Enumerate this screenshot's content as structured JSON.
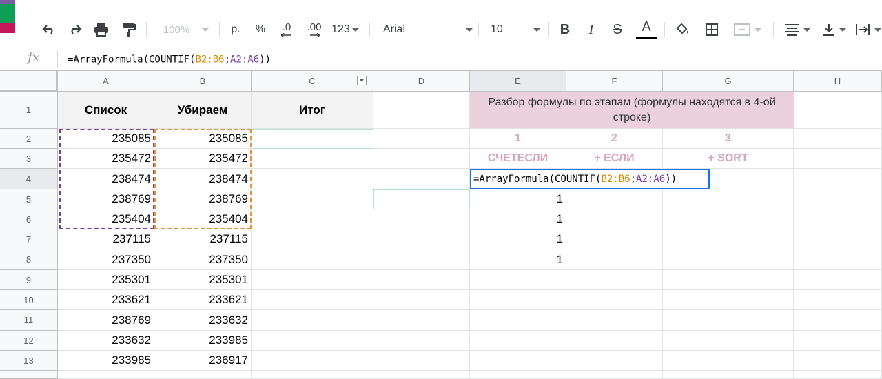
{
  "toolbar": {
    "zoom": "100%",
    "currency": "р.",
    "percent": "%",
    "dec_less": ".0",
    "dec_more": ".00",
    "more_formats": "123",
    "font": "Arial",
    "font_size": "10",
    "bold": "B",
    "italic": "I",
    "strike": "S",
    "text_color_letter": "A"
  },
  "formula_bar": {
    "fx": "fx",
    "prefix": "=ArrayFormula(COUNTIF(",
    "range1": "B2:B6",
    "sep": ";",
    "range2": "A2:A6",
    "suffix": "))"
  },
  "columns": [
    "A",
    "B",
    "C",
    "D",
    "E",
    "F",
    "G",
    "H"
  ],
  "rows": [
    "1",
    "2",
    "3",
    "4",
    "5",
    "6",
    "7",
    "8",
    "9",
    "10",
    "11",
    "12",
    "13"
  ],
  "headers": {
    "a1": "Список",
    "b1": "Убираем",
    "c1": "Итог"
  },
  "list_a": [
    "235085",
    "235472",
    "238474",
    "238769",
    "235404",
    "237115",
    "237350",
    "235301",
    "233621",
    "238769",
    "233632",
    "233985"
  ],
  "list_b": [
    "235085",
    "235472",
    "238474",
    "238769",
    "235404",
    "237115",
    "237350",
    "235301",
    "233621",
    "233632",
    "233985",
    "236917"
  ],
  "breakdown": {
    "title": "Разбор формулы по этапам (формулы находятся в 4-ой строке)",
    "stage_numbers": [
      "1",
      "2",
      "3"
    ],
    "stage_names": [
      "СЧЕТЕСЛИ",
      "+ ЕСЛИ",
      "+ SORT"
    ]
  },
  "e_results": [
    "1",
    "1",
    "1",
    "1"
  ]
}
